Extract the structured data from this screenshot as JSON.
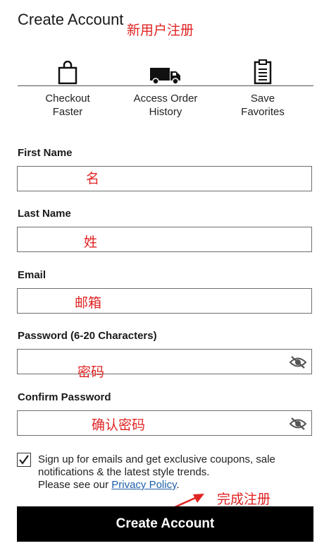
{
  "header": {
    "title": "Create Account",
    "title_annotation": "新用户注册"
  },
  "benefits": [
    {
      "icon": "shopping-bag-icon",
      "line1": "Checkout",
      "line2": "Faster"
    },
    {
      "icon": "delivery-truck-icon",
      "line1": "Access Order",
      "line2": "History"
    },
    {
      "icon": "clipboard-list-icon",
      "line1": "Save",
      "line2": "Favorites"
    }
  ],
  "form": {
    "first_name": {
      "label": "First Name",
      "annotation": "名",
      "value": ""
    },
    "last_name": {
      "label": "Last Name",
      "annotation": "姓",
      "value": ""
    },
    "email": {
      "label": "Email",
      "annotation": "邮箱",
      "value": ""
    },
    "password": {
      "label": "Password (6-20 Characters)",
      "annotation": "密码",
      "value": "",
      "icon": "eye-hidden-icon"
    },
    "confirm_password": {
      "label": "Confirm Password",
      "annotation": "确认密码",
      "value": "",
      "icon": "eye-hidden-icon"
    }
  },
  "signup": {
    "checked": true,
    "text": "Sign up for emails and get exclusive coupons, sale notifications & the latest style trends.",
    "privacy_prefix": "Please see our ",
    "privacy_link": "Privacy Policy",
    "privacy_suffix": "."
  },
  "submit": {
    "label": "Create Account",
    "annotation": "完成注册"
  },
  "colors": {
    "annotation": "#e02424",
    "button_bg": "#000000",
    "link": "#1d5fa8"
  }
}
